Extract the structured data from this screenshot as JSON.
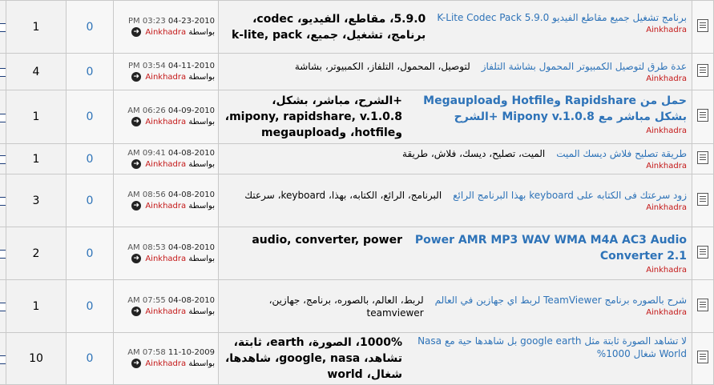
{
  "labels": {
    "by": "بواسطة"
  },
  "threads": [
    {
      "title": "برنامج تشغيل جميع مقاطع الفيديو K-Lite Codec Pack 5.9.0",
      "title_big": false,
      "author": "Ainkhadra",
      "tags": "5.9.0، مقاطع، الفيديو، codec، برنامج، تشغيل، جميع، k-lite, pack",
      "tags_big": true,
      "last_time": "PM 03:23",
      "last_date": "04-23-2010",
      "last_user": "Ainkhadra",
      "replies": "0",
      "views": "1"
    },
    {
      "title": "عدة طرق لتوصيل الكمبيوتر المحمول بشاشة التلفاز",
      "title_big": false,
      "author": "Ainkhadra",
      "tags": "لتوصيل، المحمول، التلفاز، الكمبيوتر، بشاشة",
      "tags_big": false,
      "last_time": "PM 03:54",
      "last_date": "04-11-2010",
      "last_user": "Ainkhadra",
      "replies": "0",
      "views": "4"
    },
    {
      "title": "حمل من Rapidshare وHotfile وMegaupload بشكل مباشر مع Mipony v.1.0.8 +الشرح",
      "title_big": true,
      "author": "Ainkhadra",
      "tags": "+الشرح، مباشر، بشكل، mipony, rapidshare, v.1.0.8، وhotfile، وmegaupload",
      "tags_big": true,
      "last_time": "AM 06:26",
      "last_date": "04-09-2010",
      "last_user": "Ainkhadra",
      "replies": "0",
      "views": "1"
    },
    {
      "title": "طريقة تصليح فلاش ديسك الميت",
      "title_big": false,
      "author": "Ainkhadra",
      "tags": "الميت، تصليح، ديسك، فلاش، طريقة",
      "tags_big": false,
      "last_time": "AM 09:41",
      "last_date": "04-08-2010",
      "last_user": "Ainkhadra",
      "replies": "0",
      "views": "1"
    },
    {
      "title": "زود سرعتك فى الكتابه على keyboard بهذا البرنامج الرائع",
      "title_big": false,
      "author": "Ainkhadra",
      "tags": "البرنامج، الرائع، الكتابه، بهذا، keyboard، سرعتك",
      "tags_big": false,
      "last_time": "AM 08:56",
      "last_date": "04-08-2010",
      "last_user": "Ainkhadra",
      "replies": "0",
      "views": "3"
    },
    {
      "title": "Power AMR MP3 WAV WMA M4A AC3 Audio Converter 2.1",
      "title_big": true,
      "author": "Ainkhadra",
      "tags": "audio, converter, power",
      "tags_big": true,
      "last_time": "AM 08:53",
      "last_date": "04-08-2010",
      "last_user": "Ainkhadra",
      "replies": "0",
      "views": "2"
    },
    {
      "title": "شرح بالصوره برنامج TeamViewer لربط اي جهازين في العالم",
      "title_big": false,
      "author": "Ainkhadra",
      "tags": "لربط، العالم، بالصوره، برنامج، جهازين، teamviewer",
      "tags_big": false,
      "last_time": "AM 07:55",
      "last_date": "04-08-2010",
      "last_user": "Ainkhadra",
      "replies": "0",
      "views": "1"
    },
    {
      "title": "لا تشاهد الصورة ثابتة مثل google earth بل شاهدها حية مع Nasa World شغال 1000%",
      "title_big": false,
      "author": "",
      "tags": "1000%، الصورة، earth، ثابتة، تشاهد، google, nasa، شاهدها، شغال، world",
      "tags_big": true,
      "last_time": "AM 07:58",
      "last_date": "11-10-2009",
      "last_user": "Ainkhadra",
      "replies": "0",
      "views": "10"
    }
  ]
}
